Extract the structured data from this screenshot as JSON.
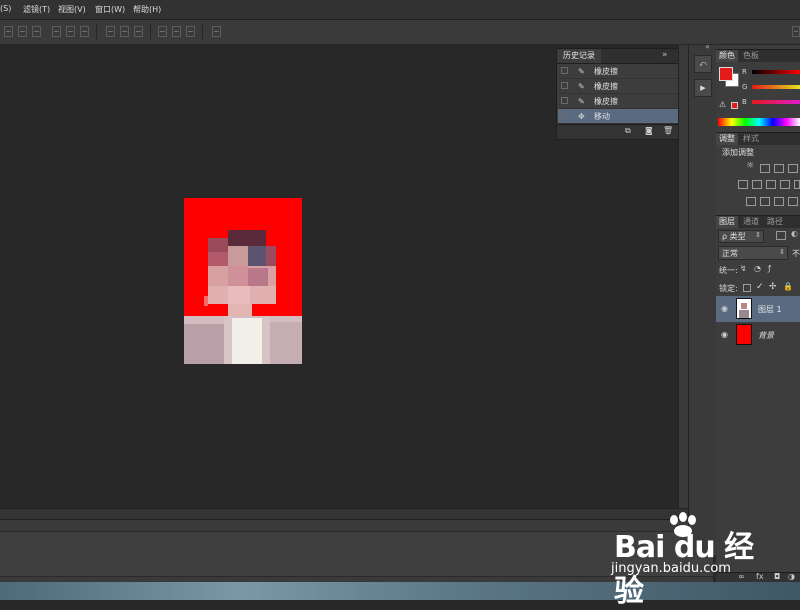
{
  "menu": {
    "items": [
      "(S)",
      "滤镜(T)",
      "视图(V)",
      "窗口(W)",
      "帮助(H)"
    ]
  },
  "history_panel": {
    "title": "历史记录",
    "collapse_symbol": "»",
    "rows": [
      {
        "label": "橡皮擦",
        "selected": false
      },
      {
        "label": "橡皮擦",
        "selected": false
      },
      {
        "label": "橡皮擦",
        "selected": false
      },
      {
        "label": "移动",
        "selected": true
      }
    ]
  },
  "color_panel": {
    "tab_color": "颜色",
    "tab_swatches": "色板",
    "channels": [
      "R",
      "G",
      "B"
    ],
    "foreground": "#e31b1b",
    "background": "#ffffff"
  },
  "adjustments_panel": {
    "tab_adjust": "调整",
    "tab_styles": "样式",
    "add_label": "添加调整"
  },
  "layers_panel": {
    "tab_layers": "图层",
    "tab_channels": "通道",
    "tab_paths": "路径",
    "filter_kind": "ρ 类型",
    "blend_mode": "正常",
    "opacity_prefix": "不",
    "unify_label": "统一:",
    "lock_label": "锁定:",
    "layers": [
      {
        "name": "图层 1",
        "selected": true,
        "kind": "photo"
      },
      {
        "name": "背景",
        "selected": false,
        "kind": "solid"
      }
    ]
  },
  "watermark": {
    "logo": "Bai du 经验",
    "url": "jingyan.baidu.com"
  },
  "colors": {
    "document_background": "#fe0000",
    "selection": "#5a6a80"
  }
}
